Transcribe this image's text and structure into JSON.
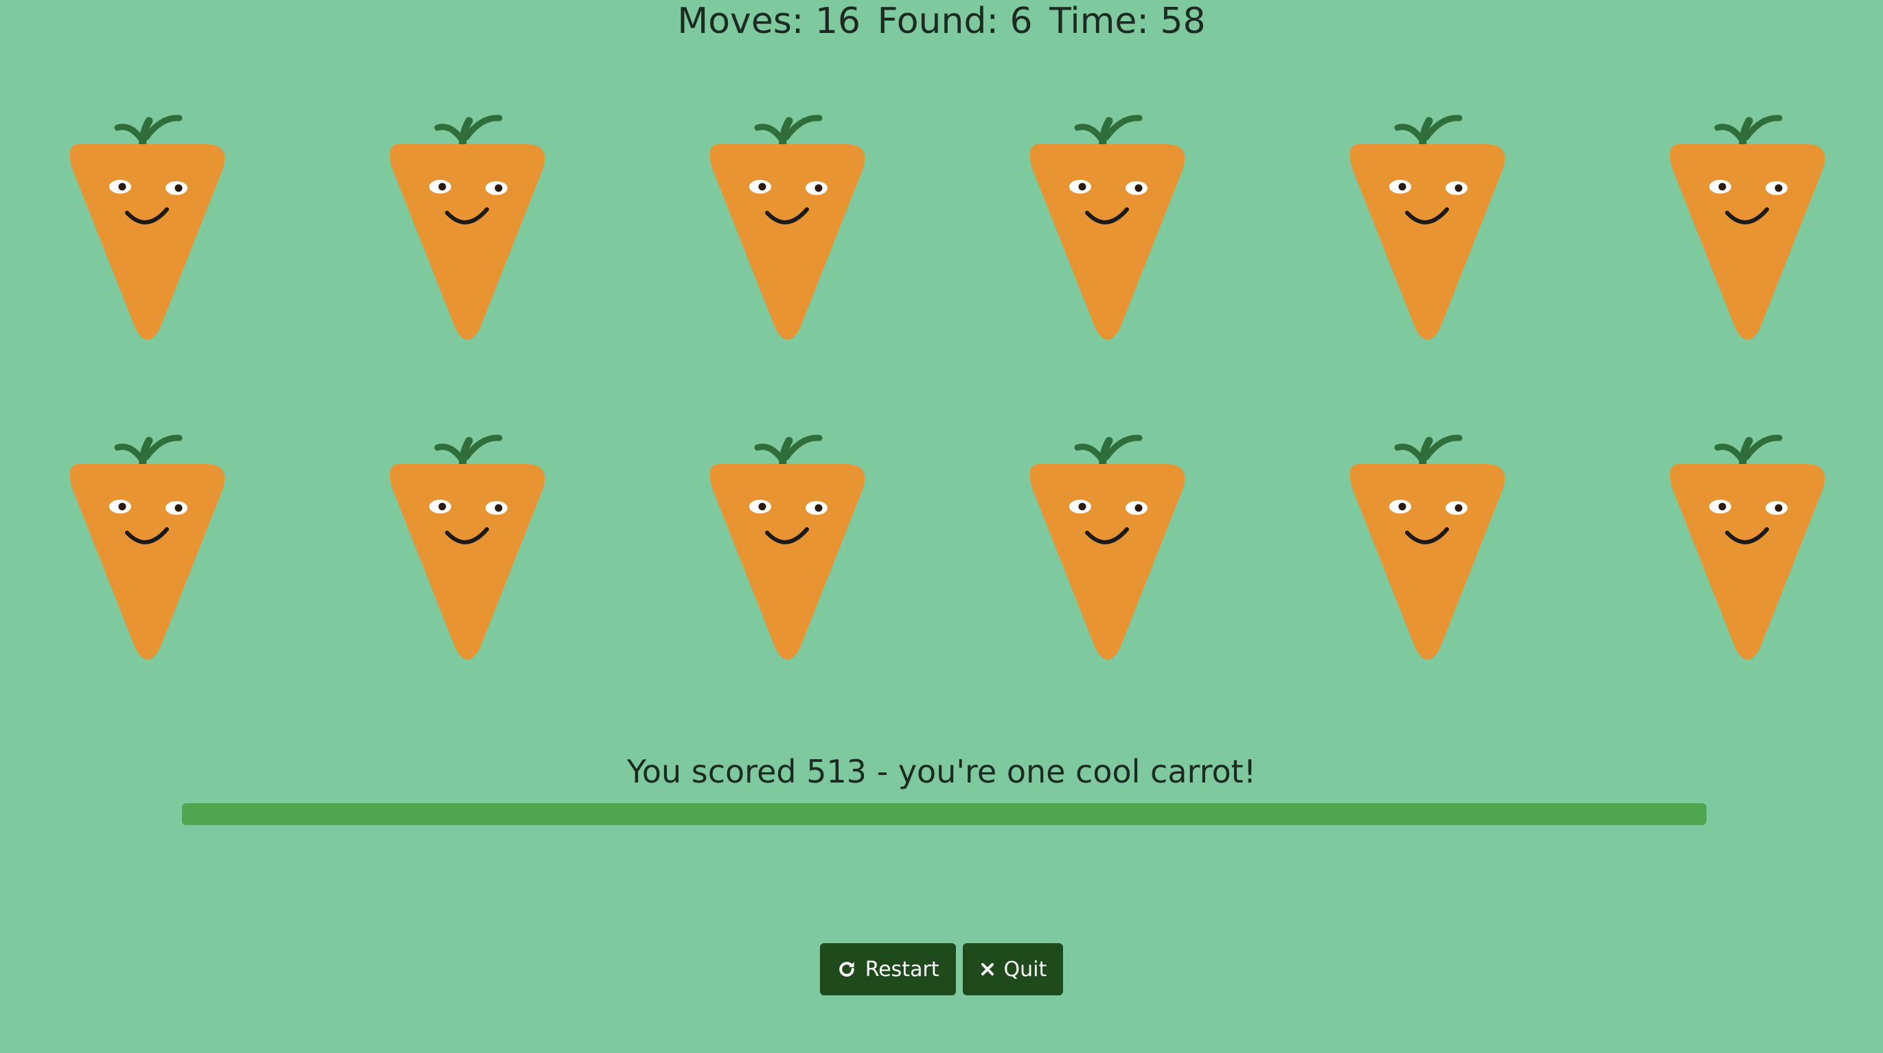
{
  "stats": {
    "moves_text": "Moves: 16",
    "found_text": "Found: 6",
    "time_text": "Time: 58"
  },
  "board": {
    "rows": 2,
    "columns": 6,
    "card_back": "carrot-face",
    "colors": {
      "carrot": "#e89433",
      "leaves": "#2f6e3a",
      "background": "#7ec99e"
    }
  },
  "result": {
    "message": "You scored 513 - you're one cool carrot!",
    "progress_fraction": 1.0
  },
  "buttons": {
    "restart_label": "Restart",
    "restart_icon": "refresh-icon",
    "quit_label": "Quit",
    "quit_icon": "close-icon",
    "color": "#1e4a1c"
  }
}
